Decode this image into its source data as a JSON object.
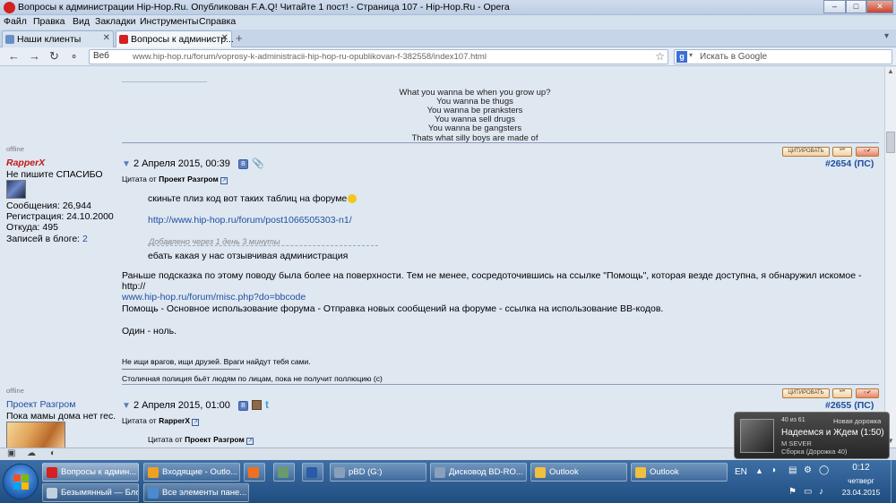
{
  "window": {
    "title": "Вопросы к администрации Hip-Hop.Ru. Опубликован F.A.Q! Читайте 1 пост! - Страница 107 - Hip-Hop.Ru - Opera"
  },
  "menu": [
    "Файл",
    "Правка",
    "Вид",
    "Закладки",
    "Инструменты",
    "Справка"
  ],
  "tabs": [
    {
      "label": "Наши клиенты"
    },
    {
      "label": "Вопросы к администр..."
    }
  ],
  "addressbar": {
    "web_label": "Веб",
    "url": "www.hip-hop.ru/forum/voprosy-k-administracii-hip-hop-ru-opublikovan-f-382558/index107.html",
    "search_placeholder": "Искать в Google"
  },
  "signature_prev": [
    "What you wanna be when you grow up?",
    "You wanna be thugs",
    "You wanna be pranksters",
    "You wanna sell drugs",
    "You wanna be gangsters",
    "Thats what silly boys are made of"
  ],
  "posts": [
    {
      "status": "offline",
      "username": "RapperX",
      "user_title": "Не пишите СПАСИБО",
      "messages": "Сообщения: 26,944",
      "registration": "Регистрация: 24.10.2000",
      "location": "Откуда: 495",
      "blog_label": "Записей в блоге:",
      "blog_count": "2",
      "date": "2 Апреля 2015, 00:39",
      "number": "#2654",
      "number_suffix": "(ПС)",
      "quote_label": "Цитата от",
      "quote_author": "Проект Разгром",
      "quote_line1": "скиньте плиз код вот таких таблиц на форуме",
      "quote_link": "http://www.hip-hop.ru/forum/post1066505303-n1/",
      "added_note": "Добавлено через 1 день 3 минуты",
      "quote_line2": "ебать какая у нас отзывчивая администрация",
      "body_p1": "Раньше подсказка по этому поводу была более на поверхности. Тем не менее, сосредоточившись на ссылке \"Помощь\", которая везде доступна, я обнаружил искомое - http://",
      "body_p1_link": "www.hip-hop.ru/forum/misc.php?do=bbcode",
      "body_p2": "Помощь - Основное использование форума - Отправка новых сообщений на форуме - ссылка на использование BB-кодов.",
      "body_p3": "Один - ноль.",
      "signature1": "Не ищи врагов, ищи друзей. Враги найдут тебя сами.",
      "signature2": "Столичная полиция бьёт людям по лицам, пока не получит поллюцию (с)"
    },
    {
      "status": "offline",
      "username": "Проект Разгром",
      "user_title": "Пока мамы дома нет rec.",
      "date": "2 Апреля 2015, 01:00",
      "number": "#2655",
      "number_suffix": "(ПС)",
      "quote_label": "Цитата от",
      "quote_author": "RapperX",
      "nested_quote_label": "Цитата от",
      "nested_quote_author": "Проект Разгром"
    }
  ],
  "buttons": {
    "quote": "ЦИТИРОВАТЬ"
  },
  "player_popup": {
    "counter": "40 из 61",
    "header": "Новая дорожка",
    "track": "Надеемся и Ждем (1:50)",
    "artist": "M SEVER",
    "album": "Сборка (Дорожка 40)"
  },
  "taskbar": {
    "row1": [
      {
        "label": "Вопросы к админ...",
        "color": "#d42020"
      },
      {
        "label": "Входящие - Outlo...",
        "color": "#f0a020"
      },
      {
        "label": "",
        "color": "#f07020"
      },
      {
        "label": "",
        "color": "#6a9a6a"
      },
      {
        "label": "",
        "color": "#2a5aa8"
      },
      {
        "label": "pBD (G:)",
        "color": "#8aa0b8"
      },
      {
        "label": "Дисковод BD-RO...",
        "color": "#8aa0b8"
      },
      {
        "label": "Outlook",
        "color": "#f0c040"
      },
      {
        "label": "Outlook",
        "color": "#f0c040"
      }
    ],
    "row2": [
      {
        "label": "Безымянный — Бло...",
        "color": "#c0d0e0"
      },
      {
        "label": "Все элементы пане...",
        "color": "#4a8ad0"
      }
    ],
    "lang": "EN",
    "time": "0:12",
    "weekday": "четверг",
    "date": "23.04.2015"
  }
}
